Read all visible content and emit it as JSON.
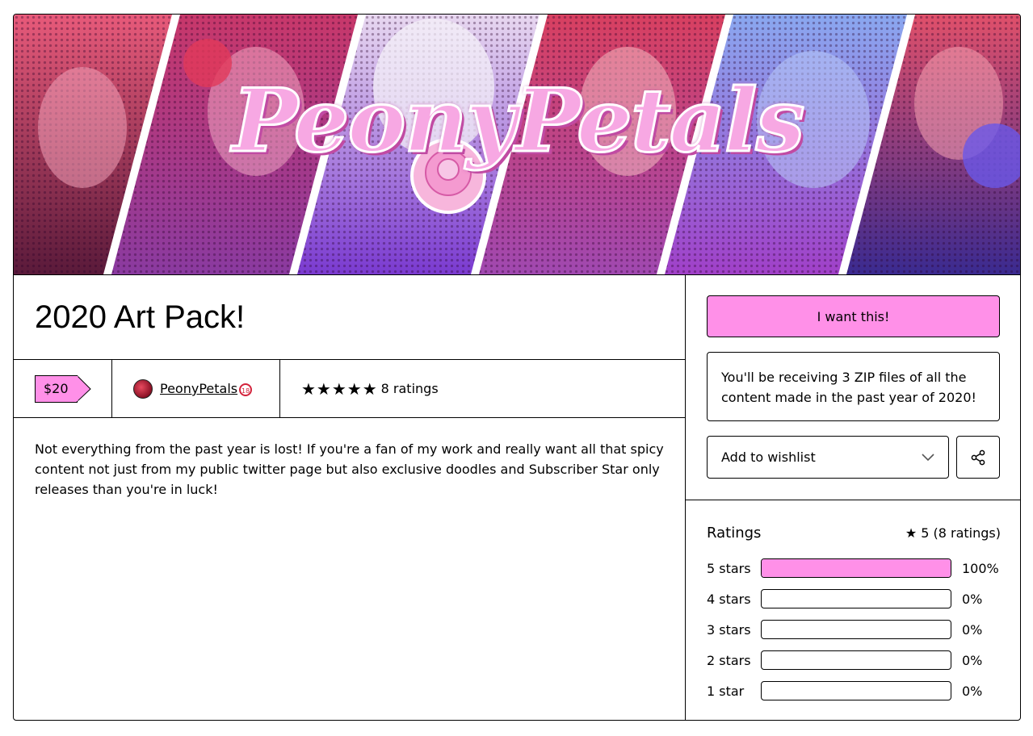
{
  "cover": {
    "brand_text": "PeonyPetals",
    "colors": {
      "pink": "#ff90e8",
      "magenta": "#d6519a",
      "violet": "#7a4ed8",
      "deep": "#3a1030"
    }
  },
  "product": {
    "title": "2020 Art Pack!",
    "price": "$20",
    "creator_name": "PeonyPetals",
    "creator_badge": "18",
    "stars_icon": "★★★★★",
    "rating_count_label": "8 ratings",
    "description": "Not everything from the past year is lost! If you're a fan of my work and really want all that spicy content not just from my public twitter page but also exclusive doodles and Subscriber Star only releases than you're in luck!"
  },
  "purchase": {
    "want_label": "I want this!",
    "summary": "You'll be receiving 3 ZIP files of all the content made in the past year of 2020!",
    "wishlist_label": "Add to wishlist",
    "accent_color": "#ff90e8"
  },
  "ratings": {
    "heading": "Ratings",
    "average_label": "5 (8 ratings)",
    "rows": [
      {
        "label": "5 stars",
        "percent_label": "100%",
        "fraction": 1.0
      },
      {
        "label": "4 stars",
        "percent_label": "0%",
        "fraction": 0
      },
      {
        "label": "3 stars",
        "percent_label": "0%",
        "fraction": 0
      },
      {
        "label": "2 stars",
        "percent_label": "0%",
        "fraction": 0
      },
      {
        "label": "1 star",
        "percent_label": "0%",
        "fraction": 0
      }
    ]
  }
}
